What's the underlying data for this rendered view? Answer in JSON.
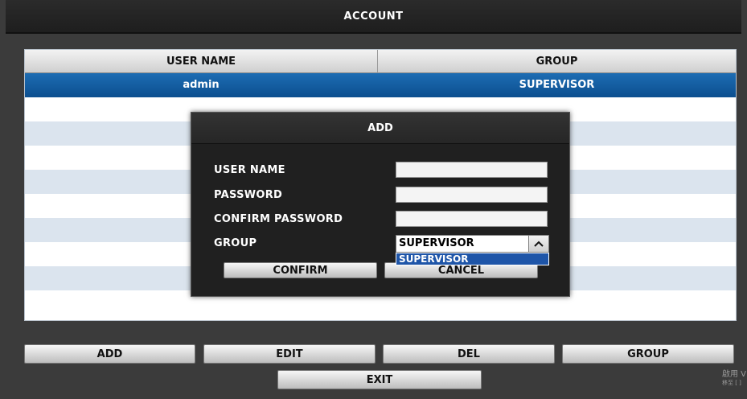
{
  "window": {
    "title": "ACCOUNT"
  },
  "table": {
    "columns": [
      "USER NAME",
      "GROUP"
    ],
    "rows": [
      {
        "user_name": "admin",
        "group": "SUPERVISOR",
        "selected": true
      }
    ]
  },
  "add_dialog": {
    "title": "ADD",
    "labels": {
      "user_name": "USER NAME",
      "password": "PASSWORD",
      "confirm_password": "CONFIRM PASSWORD",
      "group": "GROUP"
    },
    "fields": {
      "user_name": "",
      "password": "",
      "confirm_password": ""
    },
    "group_select": {
      "value": "SUPERVISOR",
      "arrow_icon": "chevron-up-icon",
      "options": [
        "SUPERVISOR"
      ]
    },
    "buttons": {
      "confirm": "CONFIRM",
      "cancel": "CANCEL"
    }
  },
  "toolbar": {
    "add": "ADD",
    "edit": "EDIT",
    "del": "DEL",
    "group": "GROUP",
    "exit": "EXIT"
  },
  "watermark": {
    "line1": "啟用 V",
    "line2": "移至 [ ]"
  },
  "colors": {
    "selected_row": "#0c5ea6",
    "stripe": "#dbe4ee",
    "dropdown_highlight": "#1e55a8"
  }
}
